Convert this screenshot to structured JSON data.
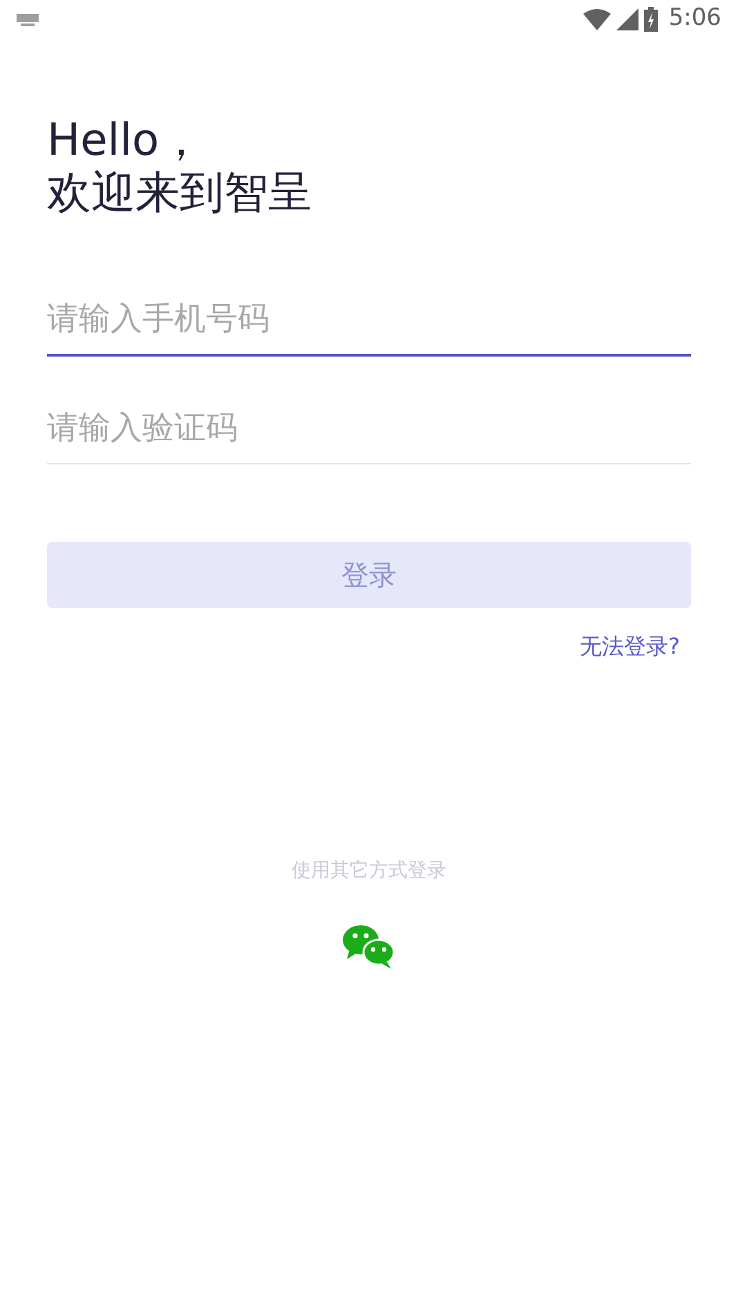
{
  "status_bar": {
    "time": "5:06"
  },
  "greeting": [
    "Hello，",
    "欢迎来到智呈"
  ],
  "fields": [
    {
      "placeholder": "请输入手机号码",
      "focused": true
    },
    {
      "placeholder": "请输入验证码",
      "focused": false
    }
  ],
  "login_button": {
    "label": "登录",
    "disabled": true
  },
  "help_link": "无法登录?",
  "other_login": {
    "label": "使用其它方式登录"
  }
}
